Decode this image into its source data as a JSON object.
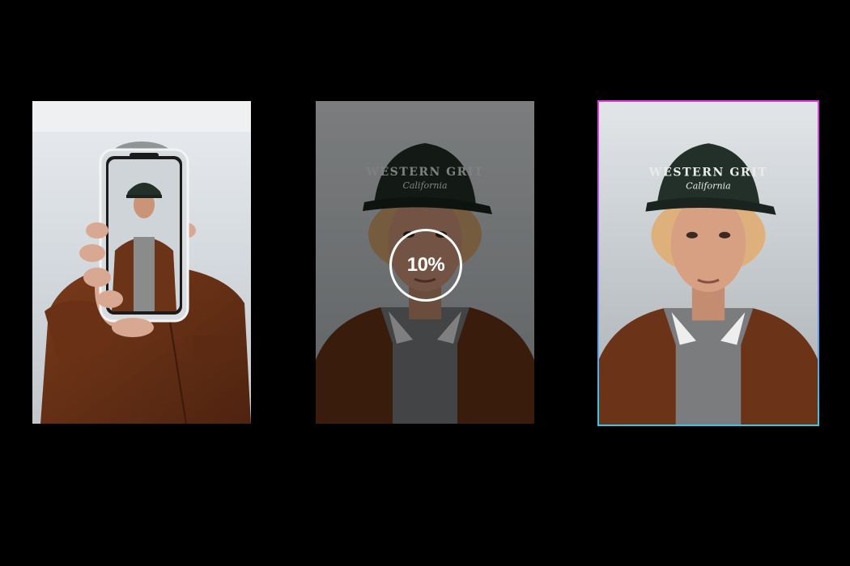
{
  "progress": {
    "value": 10,
    "label": "10%"
  },
  "panels": [
    {
      "role": "source-image",
      "depicts": "person-holding-phone"
    },
    {
      "role": "processing-image",
      "depicts": "portrait-cap"
    },
    {
      "role": "result-image",
      "depicts": "portrait-cap"
    }
  ],
  "cap_text": {
    "line1": "WESTERN GRIT",
    "line2": "California"
  },
  "colors": {
    "background": "#000000",
    "frame_gradient_top": "#e23bdc",
    "frame_gradient_bottom": "#36c8e6",
    "ring": "#ffffff",
    "jacket": "#6b3418",
    "cap": "#233029"
  }
}
